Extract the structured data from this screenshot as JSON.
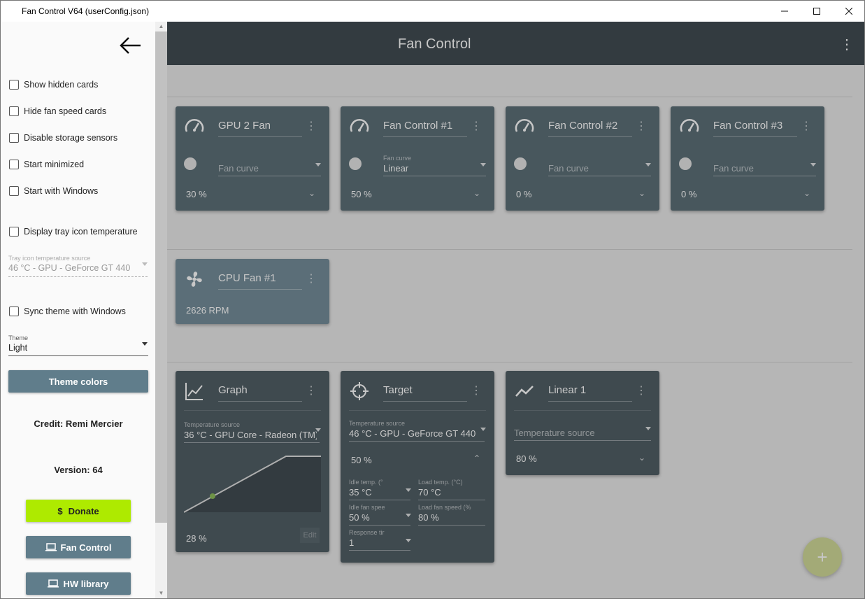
{
  "window": {
    "title": "Fan Control V64 (userConfig.json)",
    "minimize": "—",
    "maximize": "☐",
    "close": "✕"
  },
  "appbar": {
    "title": "Fan Control",
    "menu": "⋮"
  },
  "control_cards": [
    {
      "title": "GPU 2 Fan",
      "dd_label": "",
      "dd_value": "Fan curve",
      "percent": "30 %"
    },
    {
      "title": "Fan Control #1",
      "dd_label": "Fan curve",
      "dd_value": "Linear",
      "percent": "50 %"
    },
    {
      "title": "Fan Control #2",
      "dd_label": "",
      "dd_value": "Fan curve",
      "percent": "0 %"
    },
    {
      "title": "Fan Control #3",
      "dd_label": "",
      "dd_value": "Fan curve",
      "percent": "0 %"
    }
  ],
  "speed_cards": [
    {
      "title": "CPU Fan #1",
      "rpm": "2626 RPM"
    }
  ],
  "curve_cards": {
    "graph": {
      "title": "Graph",
      "dd_label": "Temperature source",
      "dd_value": "36 °C - GPU Core - Radeon (TM)",
      "percent": "28 %",
      "edit": "Edit"
    },
    "target": {
      "title": "Target",
      "dd_label": "Temperature source",
      "dd_value": "46 °C - GPU - GeForce GT 440",
      "percent": "50 %",
      "fields": [
        {
          "label": "Idle temp. (°",
          "value": "35 °C"
        },
        {
          "label": "Load temp. (°C)",
          "value": "70 °C"
        },
        {
          "label": "Idle fan spee",
          "value": "50 %"
        },
        {
          "label": "Load fan speed (%",
          "value": "80 %"
        },
        {
          "label": "Response tir",
          "value": "1"
        }
      ]
    },
    "linear": {
      "title": "Linear 1",
      "dd_value": "Temperature source",
      "percent": "80 %"
    }
  },
  "drawer": {
    "checkboxes": [
      "Show hidden cards",
      "Hide fan speed cards",
      "Disable storage sensors",
      "Start minimized",
      "Start with Windows",
      "Display tray icon temperature",
      "Sync theme with Windows"
    ],
    "tray_source": {
      "label": "Tray icon temperature source",
      "value": "46 °C - GPU - GeForce GT 440"
    },
    "theme": {
      "label": "Theme",
      "value": "Light"
    },
    "theme_colors_button": "Theme colors",
    "credit": "Credit: Remi Mercier",
    "version": "Version: 64",
    "donate_button": "Donate",
    "donate_icon": "$",
    "fan_control_button": "Fan Control",
    "hw_library_button": "HW library"
  },
  "fab": {
    "label": "+"
  },
  "colors": {
    "appbar": "#263238",
    "card_dark": "#37474f",
    "card_fan": "#455a64",
    "accent_button": "#607d8b",
    "donate": "#aeea00"
  }
}
